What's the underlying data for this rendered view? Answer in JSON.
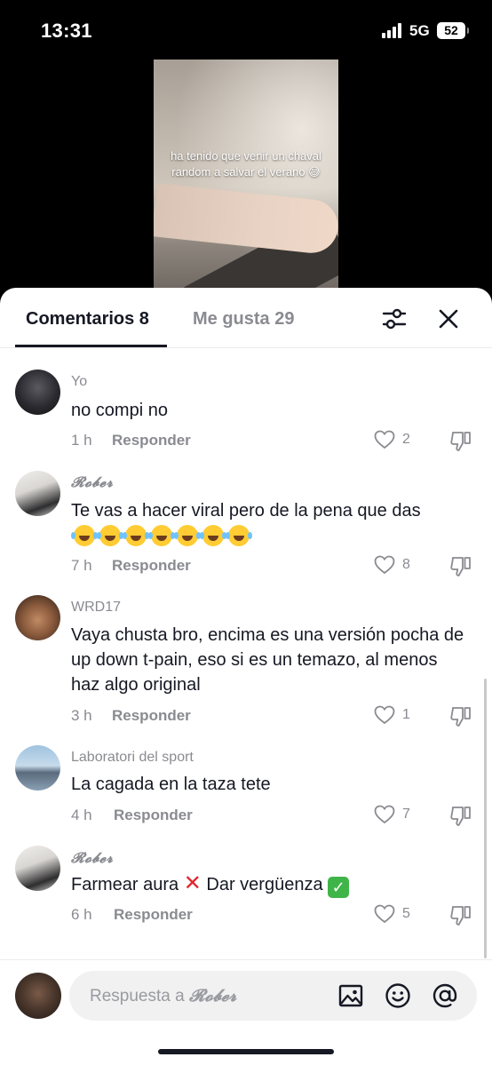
{
  "status": {
    "time": "13:31",
    "network": "5G",
    "battery": "52"
  },
  "video": {
    "caption": "ha tenido que venir un chaval random a salvar el verano 😅"
  },
  "tabs": [
    {
      "label": "Comentarios 8",
      "active": true
    },
    {
      "label": "Me gusta 29",
      "active": false
    }
  ],
  "icons": {
    "filter": "filter-sliders-icon",
    "close": "close-icon",
    "heart": "heart-icon",
    "dislike": "thumbs-down-icon",
    "image": "image-icon",
    "emoji": "smiley-icon",
    "mention": "at-icon"
  },
  "comments": [
    {
      "user": "Yo",
      "text": "no compi no",
      "time": "1 h",
      "reply": "Responder",
      "likes": "2"
    },
    {
      "user": "𝓡𝓸𝓫𝓮𝓻",
      "text": "Te vas a hacer viral pero de la pena que das",
      "emoji_line": "😂😂😂😂😂😂😂",
      "time": "7 h",
      "reply": "Responder",
      "likes": "8"
    },
    {
      "user": "WRD17",
      "text": "Vaya chusta bro, encima es una versión pocha de up down t-pain, eso si es un temazo, al menos haz algo original",
      "time": "3 h",
      "reply": "Responder",
      "likes": "1"
    },
    {
      "user": "Laboratori del sport",
      "text": "La cagada en la taza tete",
      "time": "4 h",
      "reply": "Responder",
      "likes": "7"
    },
    {
      "user": "𝓡𝓸𝓫𝓮𝓻",
      "text_a": "Farmear aura",
      "text_b": "Dar vergüenza",
      "time": "6 h",
      "reply": "Responder",
      "likes": "5"
    }
  ],
  "reply_bar": {
    "placeholder_prefix": "Respuesta a",
    "placeholder_user": "𝓡𝓸𝓫𝓮𝓻"
  },
  "colors": {
    "text": "#161823",
    "muted": "#8a8b91",
    "input_bg": "#f1f1f2"
  }
}
